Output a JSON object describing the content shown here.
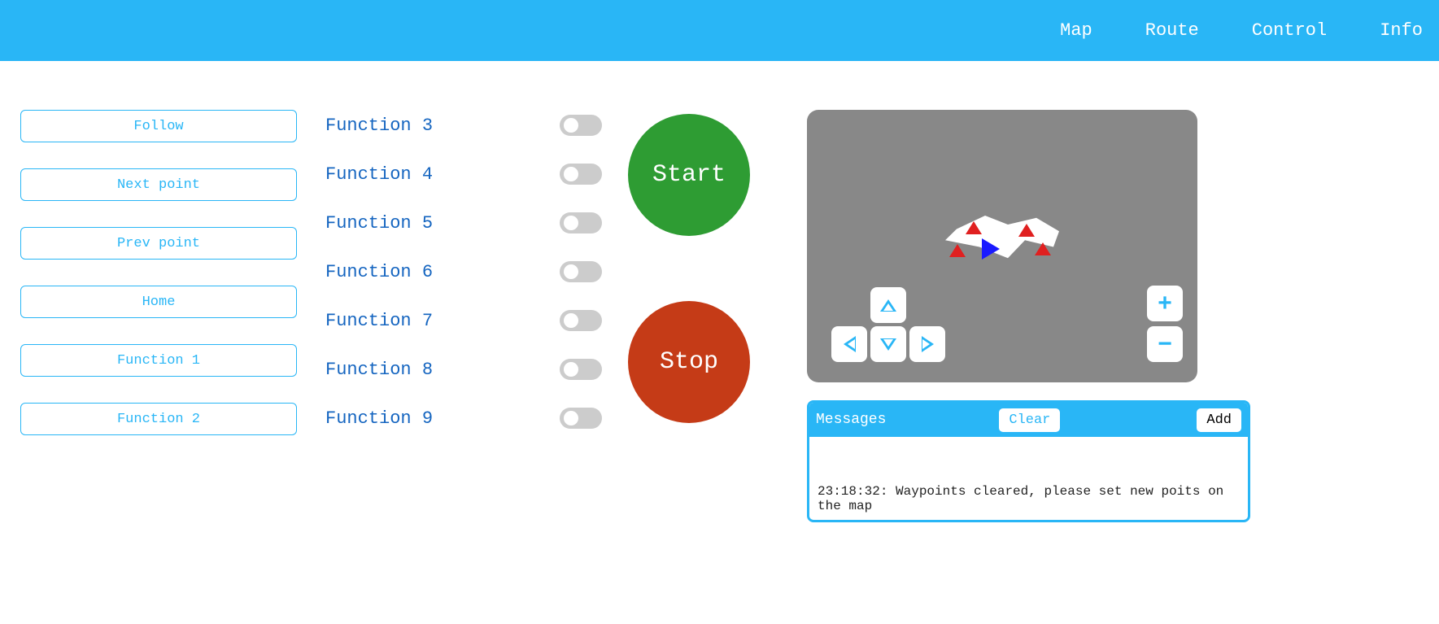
{
  "header": {
    "nav": [
      "Map",
      "Route",
      "Control",
      "Info"
    ]
  },
  "sidebar_buttons": [
    "Follow",
    "Next point",
    "Prev point",
    "Home",
    "Function 1",
    "Function 2"
  ],
  "toggles": [
    {
      "label": "Function 3",
      "on": false
    },
    {
      "label": "Function 4",
      "on": false
    },
    {
      "label": "Function 5",
      "on": false
    },
    {
      "label": "Function 6",
      "on": false
    },
    {
      "label": "Function 7",
      "on": false
    },
    {
      "label": "Function 8",
      "on": false
    },
    {
      "label": "Function 9",
      "on": false
    }
  ],
  "circles": {
    "start": "Start",
    "stop": "Stop"
  },
  "messages": {
    "title": "Messages",
    "clear": "Clear",
    "add": "Add",
    "log": [
      "23:18:32: Waypoints cleared, please set new poits on the map"
    ]
  },
  "colors": {
    "accent": "#29b6f6",
    "start": "#2e9c33",
    "stop": "#c53b17"
  }
}
